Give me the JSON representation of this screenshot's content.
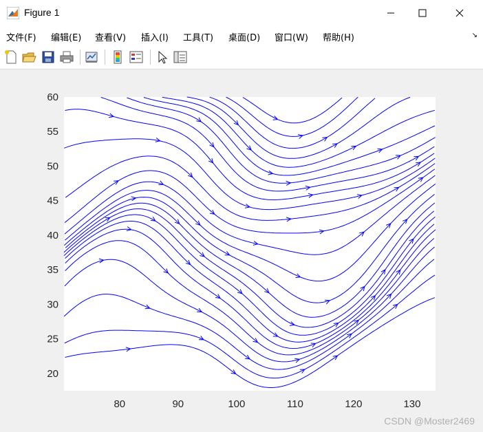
{
  "window": {
    "title": "Figure 1"
  },
  "menu": [
    {
      "label": "文件(F)"
    },
    {
      "label": "编辑(E)"
    },
    {
      "label": "查看(V)"
    },
    {
      "label": "插入(I)"
    },
    {
      "label": "工具(T)"
    },
    {
      "label": "桌面(D)"
    },
    {
      "label": "窗口(W)"
    },
    {
      "label": "帮助(H)"
    }
  ],
  "toolbar": {
    "icons": [
      "new-figure-icon",
      "open-file-icon",
      "save-icon",
      "print-icon",
      "link-plot-icon",
      "insert-colorbar-icon",
      "insert-legend-icon",
      "edit-plot-icon",
      "property-inspector-icon"
    ]
  },
  "colors": {
    "streamline": "#0000ff",
    "axes_bg": "#ffffff",
    "figure_bg": "#f0f0f0"
  },
  "chart_data": {
    "type": "streamline",
    "title": "",
    "xlabel": "",
    "ylabel": "",
    "xlim": [
      70.5,
      134
    ],
    "ylim": [
      17.5,
      60
    ],
    "xticks": [
      "80",
      "90",
      "100",
      "110",
      "120",
      "130"
    ],
    "yticks": [
      "20",
      "25",
      "30",
      "35",
      "40",
      "45",
      "50",
      "55",
      "60"
    ],
    "streamline_color": "blue",
    "grid": false,
    "legend": "none"
  },
  "watermark": "CSDN @Moster2469"
}
